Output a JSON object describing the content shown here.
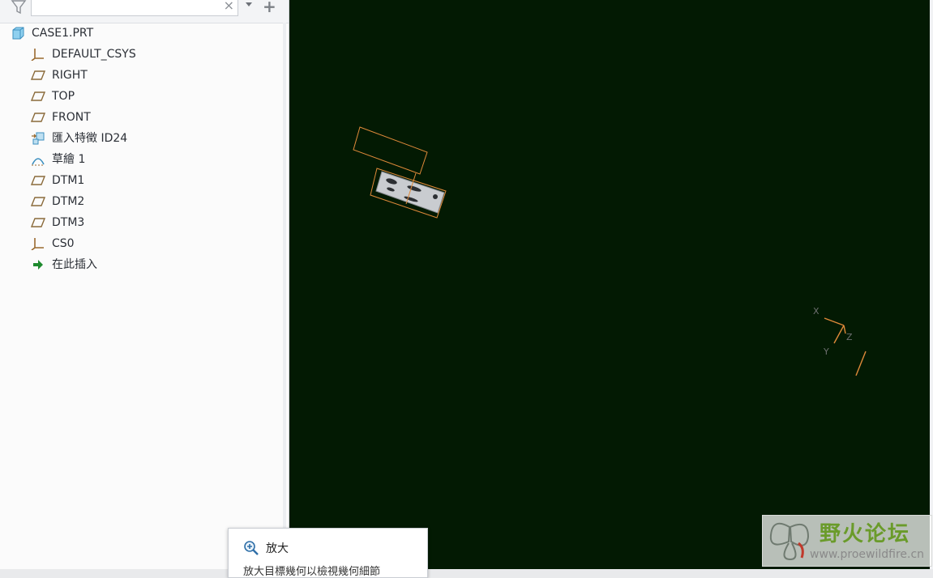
{
  "filter": {
    "placeholder": "",
    "value": ""
  },
  "tree": {
    "root": {
      "label": "CASE1.PRT",
      "icon": "part-icon"
    },
    "items": [
      {
        "label": "DEFAULT_CSYS",
        "icon": "csys-icon"
      },
      {
        "label": "RIGHT",
        "icon": "datum-plane-icon"
      },
      {
        "label": "TOP",
        "icon": "datum-plane-icon"
      },
      {
        "label": "FRONT",
        "icon": "datum-plane-icon"
      },
      {
        "label": "匯入特徵 ID24",
        "icon": "import-feature-icon"
      },
      {
        "label": "草繪 1",
        "icon": "sketch-icon"
      },
      {
        "label": "DTM1",
        "icon": "datum-plane-icon"
      },
      {
        "label": "DTM2",
        "icon": "datum-plane-icon"
      },
      {
        "label": "DTM3",
        "icon": "datum-plane-icon"
      },
      {
        "label": "CS0",
        "icon": "csys-icon"
      },
      {
        "label": "在此插入",
        "icon": "insert-here-arrow-icon"
      }
    ]
  },
  "tooltip": {
    "title": "放大",
    "description": "放大目標幾何以檢視幾何細節"
  },
  "viewport": {
    "background": "#031a03",
    "triad_labels": {
      "x": "X",
      "y": "Y",
      "z": "Z"
    }
  },
  "watermark": {
    "text": "野火论坛",
    "url": "www.proewildfire.cn"
  },
  "colors": {
    "geometry_edge": "#e08a3a",
    "datum_plane_icon": "#8a6a3a",
    "insert_arrow": "#1e8a2e"
  }
}
